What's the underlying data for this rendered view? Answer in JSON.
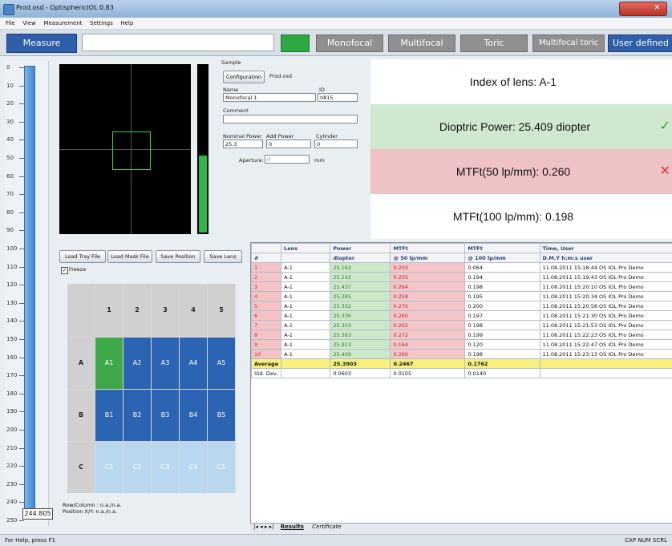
{
  "window": {
    "title": "Prod.osd - OptisphericIOL 0.83"
  },
  "menu": [
    "File",
    "View",
    "Measurement",
    "Settings",
    "Help"
  ],
  "toolbar": {
    "measure_label": "Measure",
    "input_value": "",
    "buttons": [
      "Monofocal",
      "Multifocal",
      "Toric",
      "Multifocal toric",
      "User defined"
    ]
  },
  "scale": {
    "ticks": [
      "0",
      "10",
      "20",
      "30",
      "40",
      "50",
      "60",
      "70",
      "80",
      "90",
      "100",
      "110",
      "120",
      "130",
      "140",
      "150",
      "160",
      "170",
      "180",
      "190",
      "200",
      "210",
      "220",
      "230",
      "240",
      "250"
    ],
    "value": "244.805"
  },
  "sample": {
    "group_label": "Sample",
    "config_button": "Configuration",
    "config_file": "Prod.osd",
    "name_label": "Name",
    "name_value": "Monofocal 1",
    "id_label": "ID",
    "id_value": "0815",
    "comment_label": "Comment",
    "comment_value": "",
    "nominal_label": "Nominal Power",
    "nominal_value": "25.3",
    "add_label": "Add Power",
    "add_value": "0",
    "cyl_label": "Cylinder",
    "cyl_value": "0",
    "aperture_label": "Aperture:",
    "aperture_value": "0",
    "aperture_unit": "mm"
  },
  "results": {
    "index": "Index of lens:  A-1",
    "dioptric": "Dioptric Power:  25.409 diopter",
    "mtf50": "MTFt(50 lp/mm):  0.260",
    "mtf100": "MTFt(100 lp/mm):  0.198",
    "pass_mark": "✓",
    "fail_mark": "✕",
    "colors": {
      "pass": "#cfe8cf",
      "fail": "#efc2c5"
    }
  },
  "tray": {
    "buttons": [
      "Load Tray File",
      "Load Mask File",
      "Save Position",
      "Save Lens"
    ],
    "freeze_label": "Freeze",
    "freeze_checked": true,
    "col_headers": [
      "1",
      "2",
      "3",
      "4",
      "5"
    ],
    "rows": [
      {
        "label": "A",
        "cells": [
          "A1",
          "A2",
          "A3",
          "A4",
          "A5"
        ]
      },
      {
        "label": "B",
        "cells": [
          "B1",
          "B2",
          "B3",
          "B4",
          "B5"
        ]
      },
      {
        "label": "C",
        "cells": [
          "C1",
          "C2",
          "C3",
          "C4",
          "C5"
        ]
      }
    ],
    "status_line1": "Row/Column : n.a./n.a.",
    "status_line2": "Position X/Y: n.a./n.a."
  },
  "table": {
    "headers1": [
      "",
      "Lens",
      "Power",
      "MTFt",
      "MTFt",
      "Time, User"
    ],
    "headers2": [
      "#",
      "",
      "diopter",
      "@ 50 lp/mm",
      "@ 100 lp/mm",
      "D.M.Y h:m:s user"
    ],
    "rows": [
      [
        "1",
        "A-1",
        "25.162",
        "0.203",
        "0.064",
        "11.08.2011 15:18:44 OS IOL Pro Demo"
      ],
      [
        "2",
        "A-1",
        "25.242",
        "0.255",
        "0.194",
        "11.08.2011 15:19:43 OS IOL Pro Demo"
      ],
      [
        "3",
        "A-1",
        "25.437",
        "0.264",
        "0.198",
        "11.08.2011 15:20:10 OS IOL Pro Demo"
      ],
      [
        "4",
        "A-1",
        "25.385",
        "0.258",
        "0.195",
        "11.08.2011 15:20:34 OS IOL Pro Demo"
      ],
      [
        "5",
        "A-1",
        "25.332",
        "0.270",
        "0.200",
        "11.08.2011 15:20:58 OS IOL Pro Demo"
      ],
      [
        "6",
        "A-1",
        "25.336",
        "0.260",
        "0.197",
        "11.08.2011 15:21:30 OS IOL Pro Demo"
      ],
      [
        "7",
        "A-1",
        "25.303",
        "0.262",
        "0.198",
        "11.08.2011 15:21:53 OS IOL Pro Demo"
      ],
      [
        "8",
        "A-1",
        "25.383",
        "0.272",
        "0.199",
        "11.08.2011 15:22:23 OS IOL Pro Demo"
      ],
      [
        "9",
        "A-1",
        "25.913",
        "0.164",
        "0.120",
        "11.08.2011 15:22:47 OS IOL Pro Demo"
      ],
      [
        "10",
        "A-1",
        "25.409",
        "0.260",
        "0.198",
        "11.08.2011 15:23:13 OS IOL Pro Demo"
      ]
    ],
    "average": [
      "Average",
      "",
      "25.3903",
      "0.2467",
      "0.1762",
      ""
    ],
    "stddev": [
      "Std. Dev.",
      "",
      "0.0603",
      "0.0105",
      "0.0140",
      ""
    ],
    "tabs": [
      "Results",
      "Certificate"
    ]
  },
  "status": {
    "left": "For Help, press F1",
    "right": "CAP NUM SCRL"
  }
}
